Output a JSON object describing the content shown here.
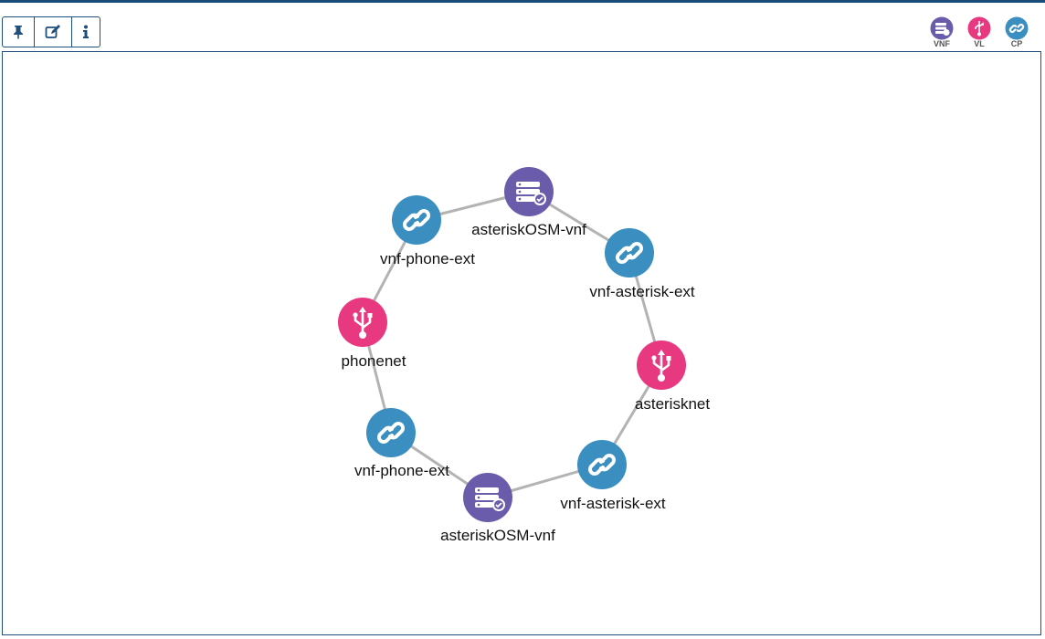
{
  "toolbar": {
    "buttons": [
      {
        "name": "pin-button",
        "icon": "pin-icon"
      },
      {
        "name": "edit-button",
        "icon": "edit-icon"
      },
      {
        "name": "info-button",
        "icon": "info-icon"
      }
    ]
  },
  "legend": {
    "vnf_label": "VNF",
    "vl_label": "VL",
    "cp_label": "CP"
  },
  "colors": {
    "vnf": "#6a5bab",
    "vl": "#e8387f",
    "cp": "#3a8fc0",
    "link": "#b3b3b3",
    "border": "#1f4f7d"
  },
  "graph": {
    "nodes": [
      {
        "id": "n1",
        "type": "vnf",
        "icon": "server-check-icon",
        "label": "asteriskOSM-vnf"
      },
      {
        "id": "n2",
        "type": "cp",
        "icon": "link-icon",
        "label": "vnf-asterisk-ext"
      },
      {
        "id": "n3",
        "type": "vl",
        "icon": "usb-icon",
        "label": "asterisknet"
      },
      {
        "id": "n4",
        "type": "cp",
        "icon": "link-icon",
        "label": "vnf-asterisk-ext"
      },
      {
        "id": "n5",
        "type": "vnf",
        "icon": "server-check-icon",
        "label": "asteriskOSM-vnf"
      },
      {
        "id": "n6",
        "type": "cp",
        "icon": "link-icon",
        "label": "vnf-phone-ext"
      },
      {
        "id": "n7",
        "type": "vl",
        "icon": "usb-icon",
        "label": "phonenet"
      },
      {
        "id": "n8",
        "type": "cp",
        "icon": "link-icon",
        "label": "vnf-phone-ext"
      }
    ],
    "links": [
      [
        "n1",
        "n2"
      ],
      [
        "n2",
        "n3"
      ],
      [
        "n3",
        "n4"
      ],
      [
        "n4",
        "n5"
      ],
      [
        "n5",
        "n6"
      ],
      [
        "n6",
        "n7"
      ],
      [
        "n7",
        "n8"
      ],
      [
        "n8",
        "n1"
      ]
    ]
  }
}
